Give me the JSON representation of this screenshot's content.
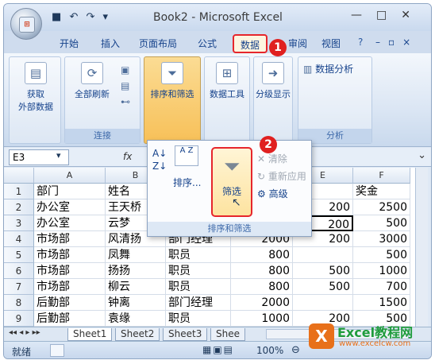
{
  "titlebar": {
    "title": "Book2 - Microsoft Excel",
    "office_logo": "Office",
    "qat_save": "■",
    "qat_undo": "↶",
    "qat_redo": "↷",
    "qat_more": "▾",
    "minimize": "—",
    "restore": "□",
    "close": "✕"
  },
  "tabs": [
    "开始",
    "插入",
    "页面布局",
    "公式",
    "数据",
    "审阅",
    "视图"
  ],
  "active_tab": "数据",
  "help_icon": "?",
  "annotations": {
    "badge1": "1",
    "badge2": "2"
  },
  "ribbon": {
    "get_external": "获取\n外部数据",
    "refresh_all": "全部刷新",
    "connections_label": "连接",
    "sort_filter": "排序和筛选",
    "data_tools": "数据工具",
    "outline": "分级显示",
    "data_analysis": "数据分析",
    "analysis_label": "分析"
  },
  "formula_bar": {
    "name_box": "E3",
    "fx": "fx"
  },
  "dropdown": {
    "az": "A Z",
    "sort_label": "排序...",
    "filter_label": "筛选",
    "clear": "清除",
    "reapply": "重新应用",
    "advanced": "高级",
    "footer": "排序和筛选"
  },
  "grid": {
    "columns": [
      "A",
      "B",
      "C",
      "D",
      "E",
      "F"
    ],
    "rows": [
      [
        "部门",
        "姓名",
        "",
        "",
        "",
        "奖金"
      ],
      [
        "办公室",
        "王天桥",
        "",
        "",
        "200",
        "2500"
      ],
      [
        "办公室",
        "云梦",
        "",
        "",
        "200",
        "500"
      ],
      [
        "市场部",
        "风清扬",
        "部门经理",
        "2000",
        "200",
        "3000"
      ],
      [
        "市场部",
        "凤舞",
        "职员",
        "800",
        "",
        "500"
      ],
      [
        "市场部",
        "扬扬",
        "职员",
        "800",
        "500",
        "1000"
      ],
      [
        "市场部",
        "柳云",
        "职员",
        "800",
        "500",
        "700"
      ],
      [
        "后勤部",
        "钟离",
        "部门经理",
        "2000",
        "",
        "1500"
      ],
      [
        "后勤部",
        "袁缘",
        "职员",
        "1000",
        "200",
        "500"
      ]
    ]
  },
  "sheets": [
    "Sheet1",
    "Sheet2",
    "Sheet3",
    "Shee"
  ],
  "status": {
    "ready": "就绪",
    "zoom": "100%"
  },
  "watermark": {
    "brand": "Excel教程网",
    "url": "www.excelcw.com"
  }
}
